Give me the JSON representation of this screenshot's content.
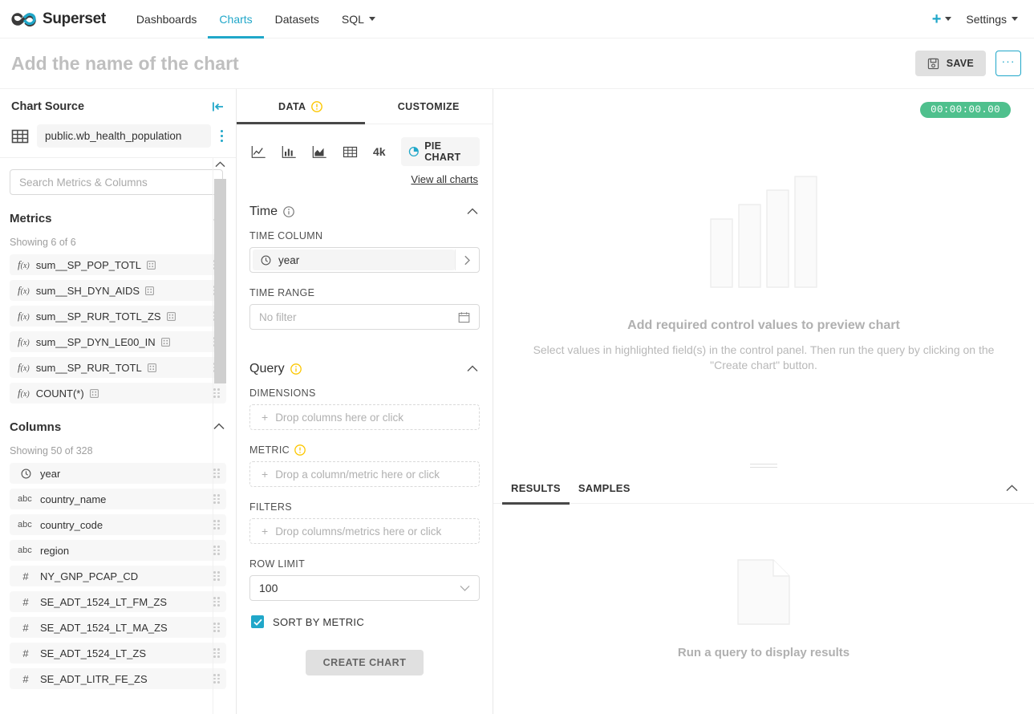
{
  "navbar": {
    "brand": "Superset",
    "links": [
      {
        "label": "Dashboards",
        "active": false
      },
      {
        "label": "Charts",
        "active": true
      },
      {
        "label": "Datasets",
        "active": false
      },
      {
        "label": "SQL",
        "active": false,
        "has_caret": true
      }
    ],
    "settings_label": "Settings",
    "accent_color": "#20a7c9"
  },
  "header": {
    "title_placeholder": "Add the name of the chart",
    "save_label": "SAVE",
    "more_label": "···"
  },
  "left_panel": {
    "title": "Chart Source",
    "dataset_name": "public.wb_health_population",
    "search_placeholder": "Search Metrics & Columns",
    "metrics": {
      "title": "Metrics",
      "showing": "Showing 6 of 6",
      "items": [
        {
          "label": "sum__SP_POP_TOTL",
          "type": "fx",
          "cert": true
        },
        {
          "label": "sum__SH_DYN_AIDS",
          "type": "fx",
          "cert": true
        },
        {
          "label": "sum__SP_RUR_TOTL_ZS",
          "type": "fx",
          "cert": true
        },
        {
          "label": "sum__SP_DYN_LE00_IN",
          "type": "fx",
          "cert": true
        },
        {
          "label": "sum__SP_RUR_TOTL",
          "type": "fx",
          "cert": true
        },
        {
          "label": "COUNT(*)",
          "type": "fx",
          "cert": true
        }
      ]
    },
    "columns": {
      "title": "Columns",
      "showing": "Showing 50 of 328",
      "items": [
        {
          "label": "year",
          "type": "time"
        },
        {
          "label": "country_name",
          "type": "abc"
        },
        {
          "label": "country_code",
          "type": "abc"
        },
        {
          "label": "region",
          "type": "abc"
        },
        {
          "label": "NY_GNP_PCAP_CD",
          "type": "num"
        },
        {
          "label": "SE_ADT_1524_LT_FM_ZS",
          "type": "num"
        },
        {
          "label": "SE_ADT_1524_LT_MA_ZS",
          "type": "num"
        },
        {
          "label": "SE_ADT_1524_LT_ZS",
          "type": "num"
        },
        {
          "label": "SE_ADT_LITR_FE_ZS",
          "type": "num"
        }
      ]
    }
  },
  "control_panel": {
    "tabs": [
      {
        "label": "DATA",
        "active": true,
        "badge": "warning"
      },
      {
        "label": "CUSTOMIZE",
        "active": false,
        "badge": "none"
      }
    ],
    "viz_icons": [
      "line-chart-icon",
      "bar-chart-icon",
      "area-chart-icon",
      "table-icon"
    ],
    "big_number_label": "4k",
    "current_viz": "PIE CHART",
    "view_all_label": "View all charts",
    "time_section": {
      "title": "Time",
      "time_column_label": "TIME COLUMN",
      "time_column_value": "year",
      "time_range_label": "TIME RANGE",
      "time_range_value": "No filter"
    },
    "query_section": {
      "title": "Query",
      "dimensions_label": "DIMENSIONS",
      "dimensions_placeholder": "Drop columns here or click",
      "metric_label": "METRIC",
      "metric_placeholder": "Drop a column/metric here or click",
      "filters_label": "FILTERS",
      "filters_placeholder": "Drop columns/metrics here or click",
      "row_limit_label": "ROW LIMIT",
      "row_limit_value": "100",
      "sort_by_metric_label": "SORT BY METRIC",
      "sort_by_metric_checked": true,
      "create_chart_label": "CREATE CHART"
    }
  },
  "chart_pane": {
    "timer": "00:00:00.00",
    "timer_color": "#4fc08d",
    "empty_title": "Add required control values to preview chart",
    "empty_subtitle": "Select values in highlighted field(s) in the control panel. Then run the query by clicking on the \"Create chart\" button.",
    "results": {
      "tabs": [
        {
          "label": "RESULTS",
          "active": true
        },
        {
          "label": "SAMPLES",
          "active": false
        }
      ],
      "empty_message": "Run a query to display results"
    }
  }
}
